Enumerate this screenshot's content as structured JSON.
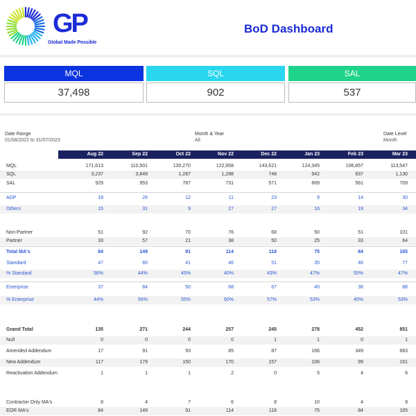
{
  "brand": {
    "logo_text": "GP",
    "tagline": "Global Made Possible"
  },
  "page_title": "BoD Dashboard",
  "kpis": [
    {
      "label": "MQL",
      "value": "37,498",
      "color": "#0c33e0"
    },
    {
      "label": "SQL",
      "value": "902",
      "color": "#29d6ef"
    },
    {
      "label": "SAL",
      "value": "537",
      "color": "#20d38a"
    }
  ],
  "filters": {
    "date_range": {
      "label": "Date Range",
      "value": "01/08/2022 to 31/07/2023"
    },
    "month_year": {
      "label": "Month & Year",
      "value": "All"
    },
    "date_level": {
      "label": "Date Level",
      "value": "Month"
    }
  },
  "table": {
    "columns": [
      "Aug 22",
      "Sep 22",
      "Oct 22",
      "Nov 22",
      "Dec 22",
      "Jan 23",
      "Feb 23",
      "Mar 23"
    ],
    "rows": [
      {
        "label": "MQL",
        "values": [
          "171,613",
          "110,501",
          "130,270",
          "122,958",
          "143,621",
          "124,345",
          "106,857",
          "113,547"
        ]
      },
      {
        "label": "SQL",
        "values": [
          "3,237",
          "3,849",
          "1,287",
          "1,298",
          "748",
          "942",
          "837",
          "1,130"
        ]
      },
      {
        "label": "SAL",
        "values": [
          "929",
          "953",
          "787",
          "731",
          "571",
          "669",
          "561",
          "709"
        ]
      },
      {
        "label": "ADP",
        "values": [
          "18",
          "26",
          "12",
          "11",
          "23",
          "9",
          "14",
          "30"
        ]
      },
      {
        "label": "Others",
        "values": [
          "15",
          "31",
          "9",
          "27",
          "27",
          "16",
          "19",
          "34"
        ]
      },
      {
        "label": "Non-Partner",
        "values": [
          "51",
          "92",
          "70",
          "76",
          "68",
          "50",
          "51",
          "101"
        ]
      },
      {
        "label": "Partner",
        "values": [
          "33",
          "57",
          "21",
          "38",
          "50",
          "25",
          "33",
          "64"
        ]
      },
      {
        "label": "Total MA's",
        "values": [
          "84",
          "149",
          "91",
          "114",
          "118",
          "75",
          "84",
          "165"
        ]
      },
      {
        "label": "Standard",
        "values": [
          "47",
          "65",
          "41",
          "46",
          "51",
          "35",
          "46",
          "77"
        ]
      },
      {
        "label": "% Standard",
        "values": [
          "56%",
          "44%",
          "45%",
          "40%",
          "43%",
          "47%",
          "55%",
          "47%"
        ]
      },
      {
        "label": "Enterprise",
        "values": [
          "37",
          "84",
          "50",
          "68",
          "67",
          "40",
          "38",
          "88"
        ]
      },
      {
        "label": "% Enterprise",
        "values": [
          "44%",
          "56%",
          "55%",
          "60%",
          "57%",
          "53%",
          "45%",
          "53%"
        ]
      },
      {
        "label": "Grand Total",
        "values": [
          "135",
          "271",
          "244",
          "257",
          "245",
          "278",
          "452",
          "851"
        ]
      },
      {
        "label": "Null",
        "values": [
          "0",
          "0",
          "0",
          "0",
          "1",
          "1",
          "0",
          "1"
        ]
      },
      {
        "label": "Amended Addendum",
        "values": [
          "17",
          "91",
          "93",
          "85",
          "87",
          "166",
          "349",
          "683"
        ]
      },
      {
        "label": "New Addendum",
        "values": [
          "117",
          "179",
          "150",
          "170",
          "157",
          "106",
          "99",
          "161"
        ]
      },
      {
        "label": "Reactivation Addendum",
        "values": [
          "1",
          "1",
          "1",
          "2",
          "0",
          "5",
          "4",
          "6"
        ]
      },
      {
        "label": "Contractor Only MA's",
        "values": [
          "8",
          "4",
          "7",
          "6",
          "8",
          "10",
          "4",
          "9"
        ]
      },
      {
        "label": "EOR MA's",
        "values": [
          "84",
          "149",
          "91",
          "114",
          "118",
          "75",
          "84",
          "165"
        ]
      }
    ]
  }
}
